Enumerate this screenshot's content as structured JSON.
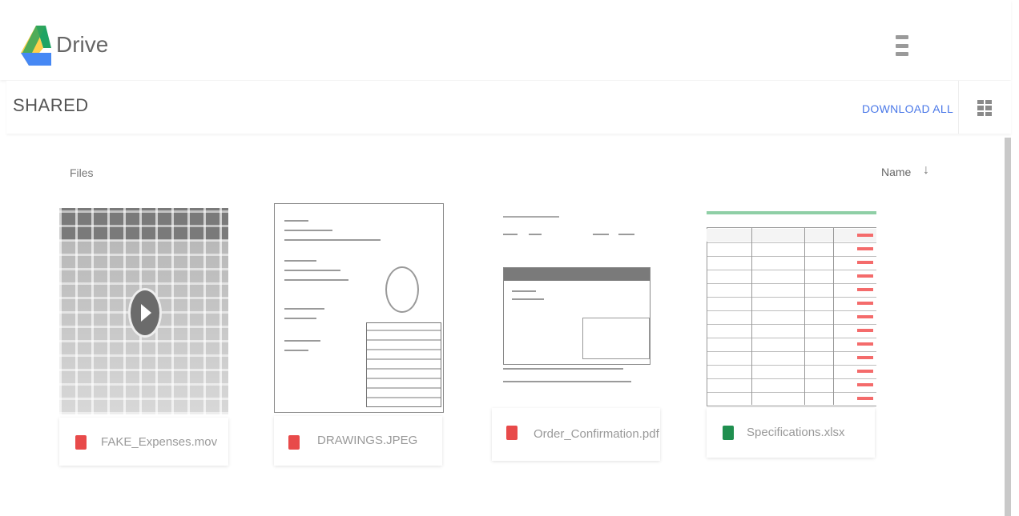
{
  "header": {
    "brand": "Drive"
  },
  "toolbar": {
    "section_title": "SHARED",
    "download_all_label": "DOWNLOAD ALL"
  },
  "list": {
    "files_label": "Files",
    "sort_label": "Name",
    "sort_direction_glyph": "↓"
  },
  "files": [
    {
      "name": "FAKE_Expenses.mov",
      "type": "video",
      "icon": "video-file-icon",
      "icon_color": "#e84a4a"
    },
    {
      "name": "DRAWINGS.JPEG",
      "type": "image",
      "icon": "image-file-icon",
      "icon_color": "#e84a4a"
    },
    {
      "name": "Order_Confirmation.pdf",
      "type": "pdf",
      "icon": "pdf-file-icon",
      "icon_color": "#e84a4a"
    },
    {
      "name": "Specifications.xlsx",
      "type": "spreadsheet",
      "icon": "spreadsheet-file-icon",
      "icon_color": "#1f8f4f"
    }
  ],
  "colors": {
    "accent_blue": "#4a78e8",
    "logo_green": "#1fa463",
    "logo_yellow": "#ffd04b",
    "logo_blue": "#4688f4"
  }
}
